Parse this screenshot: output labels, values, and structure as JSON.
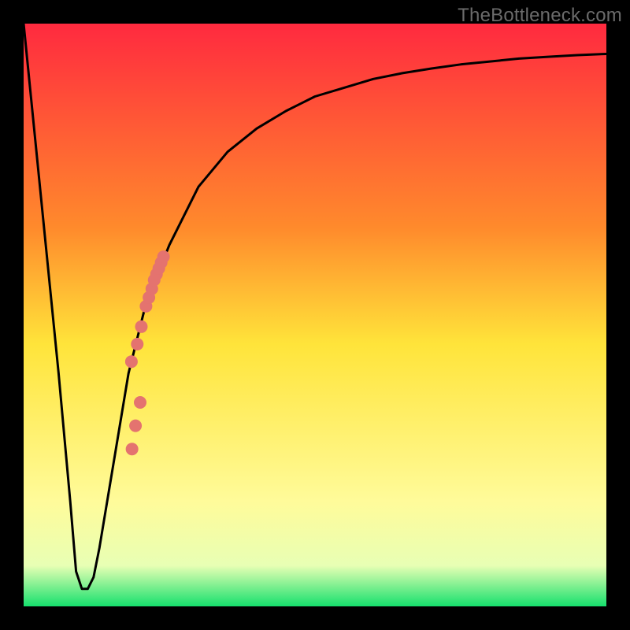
{
  "watermark": "TheBottleneck.com",
  "chart_data": {
    "type": "line",
    "title": "",
    "xlabel": "",
    "ylabel": "",
    "xlim": [
      0,
      100
    ],
    "ylim": [
      0,
      100
    ],
    "background": "rainbow-gradient",
    "background_stops": [
      {
        "pct": 0,
        "color": "#ff2a3f"
      },
      {
        "pct": 35,
        "color": "#ff8a2c"
      },
      {
        "pct": 55,
        "color": "#ffe43a"
      },
      {
        "pct": 82,
        "color": "#fffb9a"
      },
      {
        "pct": 93,
        "color": "#e8ffb4"
      },
      {
        "pct": 100,
        "color": "#16e06d"
      }
    ],
    "series": [
      {
        "name": "bottleneck-curve",
        "stroke": "#000000",
        "x": [
          0,
          2,
          4,
          6,
          8,
          9,
          10,
          11,
          12,
          13,
          15,
          18,
          21,
          25,
          30,
          35,
          40,
          45,
          50,
          55,
          60,
          65,
          70,
          75,
          80,
          85,
          90,
          95,
          100
        ],
        "y": [
          100,
          80,
          60,
          40,
          18,
          6,
          3,
          3,
          5,
          10,
          22,
          40,
          52,
          62,
          72,
          78,
          82,
          85,
          87.5,
          89,
          90.5,
          91.5,
          92.3,
          93,
          93.5,
          94,
          94.3,
          94.6,
          94.8
        ]
      }
    ],
    "scatter": {
      "name": "red-dots",
      "color": "#e4736f",
      "points": [
        {
          "x": 18.5,
          "y": 42
        },
        {
          "x": 19.5,
          "y": 45
        },
        {
          "x": 20.2,
          "y": 48
        },
        {
          "x": 21.0,
          "y": 51.5
        },
        {
          "x": 21.5,
          "y": 53
        },
        {
          "x": 22.0,
          "y": 54.5
        },
        {
          "x": 22.4,
          "y": 56
        },
        {
          "x": 22.8,
          "y": 57
        },
        {
          "x": 23.2,
          "y": 58
        },
        {
          "x": 23.6,
          "y": 59
        },
        {
          "x": 24.0,
          "y": 60
        },
        {
          "x": 20.0,
          "y": 35
        },
        {
          "x": 19.2,
          "y": 31
        },
        {
          "x": 18.6,
          "y": 27
        }
      ]
    }
  }
}
